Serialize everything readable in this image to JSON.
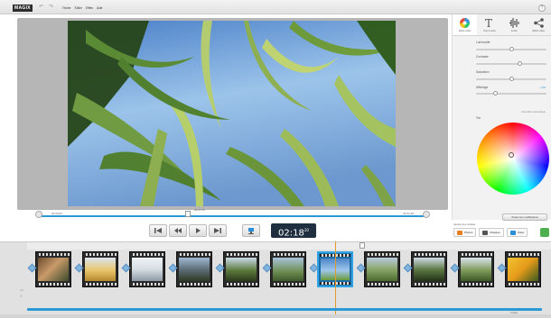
{
  "app": {
    "logo": "MAGIX",
    "undo_icon": "undo-icon",
    "redo_icon": "redo-icon",
    "menu": [
      "Fichier",
      "Éditer",
      "Effets",
      "Aide"
    ],
    "help": "?"
  },
  "preview": {
    "timecode_start": "00:00:00",
    "timecode_mid": "00:07:26",
    "timecode_end": "00:41:28",
    "current_time": "02:18",
    "current_time_frames": "20"
  },
  "panel": {
    "tabs": [
      {
        "label": "Effets vidéo",
        "icon": "color-wheel-icon"
      },
      {
        "label": "Titre & texte",
        "icon": "text-icon"
      },
      {
        "label": "Audio",
        "icon": "audio-wave-icon"
      },
      {
        "label": "Effets vidéo",
        "icon": "share-icon"
      }
    ],
    "sliders": [
      {
        "label": "Luminosité",
        "level": 0.5
      },
      {
        "label": "Contraste",
        "level": 0.62
      },
      {
        "label": "Saturation",
        "level": 0.5
      },
      {
        "label": "Affichage",
        "level": 0.28,
        "value": "1,00"
      }
    ],
    "tone_label": "Ton",
    "auto_label": "Correction automatique",
    "reset_label": "Toutes les modifications"
  },
  "media": {
    "label": "Ajouter des médias :",
    "buttons": [
      {
        "label": "Photos",
        "icon": "photo-icon",
        "color": "#e67e22"
      },
      {
        "label": "Musique",
        "icon": "music-icon",
        "color": "#555555"
      },
      {
        "label": "Vidéo",
        "icon": "video-icon",
        "color": "#2a8fd6"
      }
    ],
    "go_color": "#4caf50"
  },
  "timeline": {
    "clips": [
      {
        "name": "portrait"
      },
      {
        "name": "wheat field"
      },
      {
        "name": "snowy landscape"
      },
      {
        "name": "mountains"
      },
      {
        "name": "tree scene"
      },
      {
        "name": "green field"
      },
      {
        "name": "bamboo sky",
        "selected": true
      },
      {
        "name": "tall grass"
      },
      {
        "name": "forest"
      },
      {
        "name": "woman meadow"
      },
      {
        "name": "flowers"
      }
    ],
    "info": "0 objet"
  },
  "colors": {
    "accent": "#2a9ad6",
    "time_display": "#1f2f3f"
  }
}
